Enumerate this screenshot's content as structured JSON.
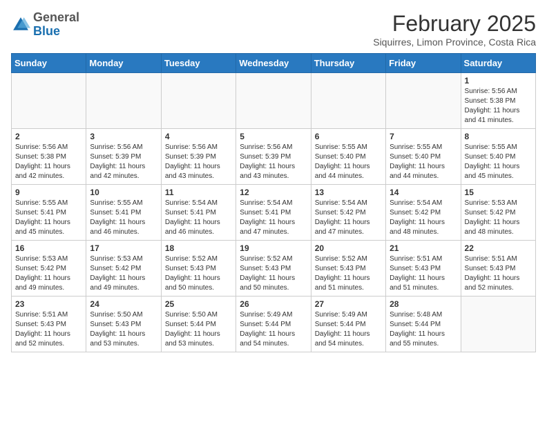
{
  "header": {
    "logo_general": "General",
    "logo_blue": "Blue",
    "month_year": "February 2025",
    "location": "Siquirres, Limon Province, Costa Rica"
  },
  "days_of_week": [
    "Sunday",
    "Monday",
    "Tuesday",
    "Wednesday",
    "Thursday",
    "Friday",
    "Saturday"
  ],
  "weeks": [
    [
      {
        "day": "",
        "info": ""
      },
      {
        "day": "",
        "info": ""
      },
      {
        "day": "",
        "info": ""
      },
      {
        "day": "",
        "info": ""
      },
      {
        "day": "",
        "info": ""
      },
      {
        "day": "",
        "info": ""
      },
      {
        "day": "1",
        "info": "Sunrise: 5:56 AM\nSunset: 5:38 PM\nDaylight: 11 hours\nand 41 minutes."
      }
    ],
    [
      {
        "day": "2",
        "info": "Sunrise: 5:56 AM\nSunset: 5:38 PM\nDaylight: 11 hours\nand 42 minutes."
      },
      {
        "day": "3",
        "info": "Sunrise: 5:56 AM\nSunset: 5:39 PM\nDaylight: 11 hours\nand 42 minutes."
      },
      {
        "day": "4",
        "info": "Sunrise: 5:56 AM\nSunset: 5:39 PM\nDaylight: 11 hours\nand 43 minutes."
      },
      {
        "day": "5",
        "info": "Sunrise: 5:56 AM\nSunset: 5:39 PM\nDaylight: 11 hours\nand 43 minutes."
      },
      {
        "day": "6",
        "info": "Sunrise: 5:55 AM\nSunset: 5:40 PM\nDaylight: 11 hours\nand 44 minutes."
      },
      {
        "day": "7",
        "info": "Sunrise: 5:55 AM\nSunset: 5:40 PM\nDaylight: 11 hours\nand 44 minutes."
      },
      {
        "day": "8",
        "info": "Sunrise: 5:55 AM\nSunset: 5:40 PM\nDaylight: 11 hours\nand 45 minutes."
      }
    ],
    [
      {
        "day": "9",
        "info": "Sunrise: 5:55 AM\nSunset: 5:41 PM\nDaylight: 11 hours\nand 45 minutes."
      },
      {
        "day": "10",
        "info": "Sunrise: 5:55 AM\nSunset: 5:41 PM\nDaylight: 11 hours\nand 46 minutes."
      },
      {
        "day": "11",
        "info": "Sunrise: 5:54 AM\nSunset: 5:41 PM\nDaylight: 11 hours\nand 46 minutes."
      },
      {
        "day": "12",
        "info": "Sunrise: 5:54 AM\nSunset: 5:41 PM\nDaylight: 11 hours\nand 47 minutes."
      },
      {
        "day": "13",
        "info": "Sunrise: 5:54 AM\nSunset: 5:42 PM\nDaylight: 11 hours\nand 47 minutes."
      },
      {
        "day": "14",
        "info": "Sunrise: 5:54 AM\nSunset: 5:42 PM\nDaylight: 11 hours\nand 48 minutes."
      },
      {
        "day": "15",
        "info": "Sunrise: 5:53 AM\nSunset: 5:42 PM\nDaylight: 11 hours\nand 48 minutes."
      }
    ],
    [
      {
        "day": "16",
        "info": "Sunrise: 5:53 AM\nSunset: 5:42 PM\nDaylight: 11 hours\nand 49 minutes."
      },
      {
        "day": "17",
        "info": "Sunrise: 5:53 AM\nSunset: 5:42 PM\nDaylight: 11 hours\nand 49 minutes."
      },
      {
        "day": "18",
        "info": "Sunrise: 5:52 AM\nSunset: 5:43 PM\nDaylight: 11 hours\nand 50 minutes."
      },
      {
        "day": "19",
        "info": "Sunrise: 5:52 AM\nSunset: 5:43 PM\nDaylight: 11 hours\nand 50 minutes."
      },
      {
        "day": "20",
        "info": "Sunrise: 5:52 AM\nSunset: 5:43 PM\nDaylight: 11 hours\nand 51 minutes."
      },
      {
        "day": "21",
        "info": "Sunrise: 5:51 AM\nSunset: 5:43 PM\nDaylight: 11 hours\nand 51 minutes."
      },
      {
        "day": "22",
        "info": "Sunrise: 5:51 AM\nSunset: 5:43 PM\nDaylight: 11 hours\nand 52 minutes."
      }
    ],
    [
      {
        "day": "23",
        "info": "Sunrise: 5:51 AM\nSunset: 5:43 PM\nDaylight: 11 hours\nand 52 minutes."
      },
      {
        "day": "24",
        "info": "Sunrise: 5:50 AM\nSunset: 5:43 PM\nDaylight: 11 hours\nand 53 minutes."
      },
      {
        "day": "25",
        "info": "Sunrise: 5:50 AM\nSunset: 5:44 PM\nDaylight: 11 hours\nand 53 minutes."
      },
      {
        "day": "26",
        "info": "Sunrise: 5:49 AM\nSunset: 5:44 PM\nDaylight: 11 hours\nand 54 minutes."
      },
      {
        "day": "27",
        "info": "Sunrise: 5:49 AM\nSunset: 5:44 PM\nDaylight: 11 hours\nand 54 minutes."
      },
      {
        "day": "28",
        "info": "Sunrise: 5:48 AM\nSunset: 5:44 PM\nDaylight: 11 hours\nand 55 minutes."
      },
      {
        "day": "",
        "info": ""
      }
    ]
  ]
}
